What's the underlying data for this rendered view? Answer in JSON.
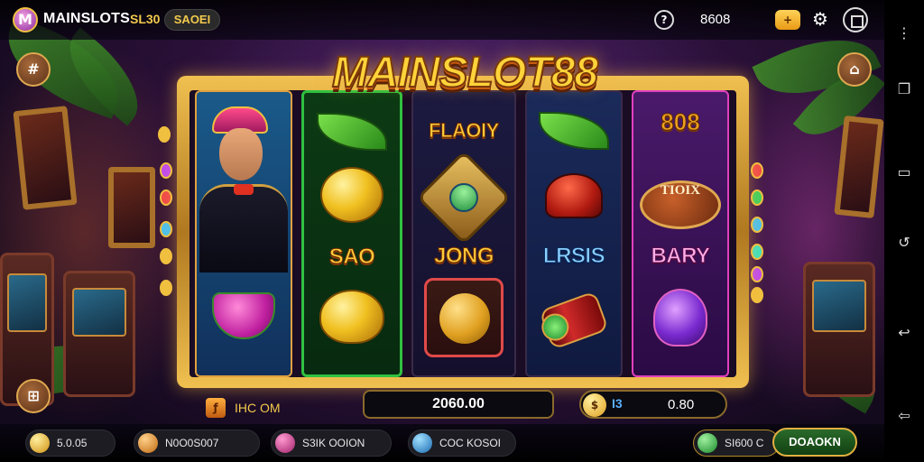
{
  "topbar": {
    "logo_letter": "M",
    "brand": "MAINSLOTS",
    "tag1": "SL30",
    "tag2": "SAOEI",
    "help_icon": "?",
    "score": "8608",
    "coin_button_icon": "+",
    "gear_icon": "⚙"
  },
  "title": "MAINSLOT88",
  "reels": {
    "r2_text": "SAO",
    "r3_top_text": "FLAOIY",
    "r3_text": "JONG",
    "r4_text": "LRSIS",
    "r5_logo": "808",
    "r5_plaque": "TIOIX",
    "r5_text": "BARY"
  },
  "side_buttons": {
    "top_left_icon": "#",
    "top_right_icon": "⌂",
    "bottom_left_icon": "⊞"
  },
  "info_row": {
    "label_icon": "ƒ",
    "label": "IHC OM",
    "win_value": "2060.00",
    "bet_coin": "$",
    "bet_label": "I3",
    "bet_value": "0.80"
  },
  "bottombar": {
    "pills": [
      {
        "text": "5.0.05"
      },
      {
        "text": "N0O0S007"
      },
      {
        "text": "S3IK OOION"
      },
      {
        "text": "COC KOSOI"
      },
      {
        "text": "SI600 C"
      }
    ],
    "main_button": "DOAOKN"
  },
  "colors": {
    "accent_gold": "#f2c94c",
    "frame_gold": "#f0c050",
    "green_button": "#2a6a2a"
  },
  "navbar": {
    "icons": [
      "more-icon",
      "recent-apps-icon",
      "square-icon",
      "rotate-icon",
      "back-icon",
      "back-arrow-icon"
    ]
  }
}
